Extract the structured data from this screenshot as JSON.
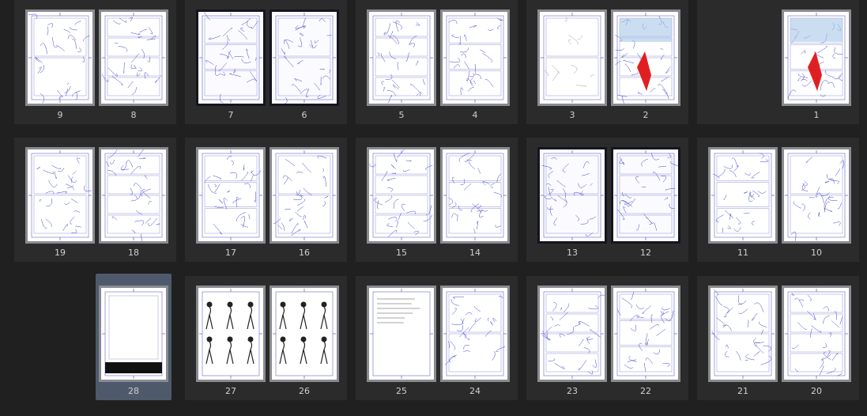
{
  "app": {
    "view": "page-manager",
    "selected_page": "28"
  },
  "colors": {
    "background": "#202020",
    "spread_bg": "#2b2b2b",
    "selection": "#4e5a6c",
    "sketch_blue": "#3f3fcf",
    "sketch_red": "#e02020",
    "page_number": "#cfcfcf"
  },
  "rows": [
    {
      "spreads": [
        {
          "left": {
            "num": "9",
            "style": "sketch"
          },
          "right": {
            "num": "8",
            "style": "sketch"
          }
        },
        {
          "left": {
            "num": "7",
            "style": "dark-sketch"
          },
          "right": {
            "num": "6",
            "style": "dark-sketch"
          }
        },
        {
          "left": {
            "num": "5",
            "style": "sketch"
          },
          "right": {
            "num": "4",
            "style": "sketch"
          }
        },
        {
          "left": {
            "num": "3",
            "style": "light-sketch"
          },
          "right": {
            "num": "2",
            "style": "color-sketch"
          }
        },
        {
          "left": null,
          "right": {
            "num": "1",
            "style": "color-sketch"
          }
        }
      ]
    },
    {
      "spreads": [
        {
          "left": {
            "num": "19",
            "style": "sketch"
          },
          "right": {
            "num": "18",
            "style": "sketch"
          }
        },
        {
          "left": {
            "num": "17",
            "style": "sketch"
          },
          "right": {
            "num": "16",
            "style": "sketch"
          }
        },
        {
          "left": {
            "num": "15",
            "style": "sketch"
          },
          "right": {
            "num": "14",
            "style": "sketch"
          }
        },
        {
          "left": {
            "num": "13",
            "style": "dark-sketch"
          },
          "right": {
            "num": "12",
            "style": "dark-sketch"
          }
        },
        {
          "left": {
            "num": "11",
            "style": "sketch"
          },
          "right": {
            "num": "10",
            "style": "sketch"
          }
        }
      ]
    },
    {
      "spreads": [
        {
          "left": null,
          "right": {
            "num": "28",
            "style": "cover"
          }
        },
        {
          "left": {
            "num": "27",
            "style": "character-sheet"
          },
          "right": {
            "num": "26",
            "style": "character-sheet"
          }
        },
        {
          "left": {
            "num": "25",
            "style": "text"
          },
          "right": {
            "num": "24",
            "style": "sketch"
          }
        },
        {
          "left": {
            "num": "23",
            "style": "sketch"
          },
          "right": {
            "num": "22",
            "style": "sketch"
          }
        },
        {
          "left": {
            "num": "21",
            "style": "sketch"
          },
          "right": {
            "num": "20",
            "style": "sketch"
          }
        }
      ]
    }
  ]
}
